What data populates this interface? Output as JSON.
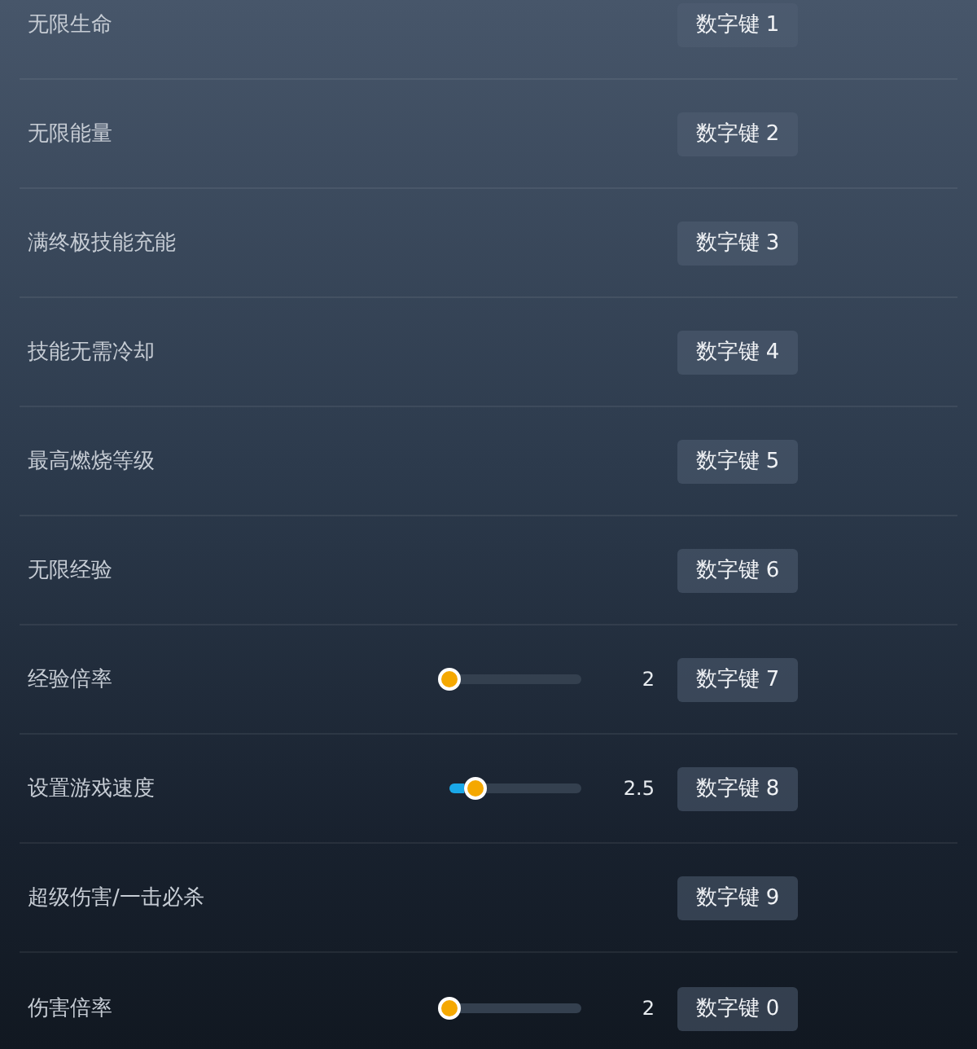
{
  "options": [
    {
      "kind": "toggle",
      "label": "无限生命",
      "hotkey": "数字键 1"
    },
    {
      "kind": "toggle",
      "label": "无限能量",
      "hotkey": "数字键 2"
    },
    {
      "kind": "toggle",
      "label": "满终极技能充能",
      "hotkey": "数字键 3"
    },
    {
      "kind": "toggle",
      "label": "技能无需冷却",
      "hotkey": "数字键 4"
    },
    {
      "kind": "toggle",
      "label": "最高燃烧等级",
      "hotkey": "数字键 5"
    },
    {
      "kind": "toggle",
      "label": "无限经验",
      "hotkey": "数字键 6"
    },
    {
      "kind": "slider",
      "label": "经验倍率",
      "level": 0,
      "reading": "2",
      "hotkey": "数字键 7"
    },
    {
      "kind": "slider",
      "label": "设置游戏速度",
      "level": 0.2,
      "reading": "2.5",
      "hotkey": "数字键 8"
    },
    {
      "kind": "toggle",
      "label": "超级伤害/一击必杀",
      "hotkey": "数字键 9"
    },
    {
      "kind": "slider",
      "label": "伤害倍率",
      "level": 0,
      "reading": "2",
      "hotkey": "数字键 0"
    }
  ]
}
